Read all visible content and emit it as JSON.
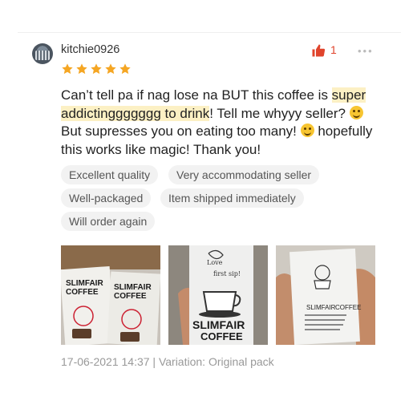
{
  "review": {
    "username": "kitchie0926",
    "rating": 5,
    "like_count": "1",
    "more_label": "•••",
    "text_part1": "Can’t tell pa if nag lose na BUT this coffee is ",
    "text_highlight": "super addictinggggggg to drink",
    "text_part2": "! Tell me whyyy seller? ",
    "text_part3": " But supresses you on eating too many! ",
    "text_part4": " hopefully this works like magic! Thank you!",
    "tags": [
      "Excellent quality",
      "Very accommodating seller",
      "Well-packaged",
      "Item shipped immediately",
      "Will order again"
    ],
    "photos": [
      {
        "label_brand": "SLIMFAIR",
        "label_product": "COFFEE"
      },
      {
        "label_brand": "SLIMFAIR",
        "label_product": "COFFEE"
      },
      {
        "label_brand": "SLIMFAIR",
        "label_product": "COFFEE"
      }
    ],
    "footer": "17-06-2021 14:37 | Variation: Original pack"
  },
  "colors": {
    "accent": "#e0442c",
    "star": "#f5a623",
    "highlight": "#fcf0c4",
    "tag_bg": "#f2f2f2"
  }
}
